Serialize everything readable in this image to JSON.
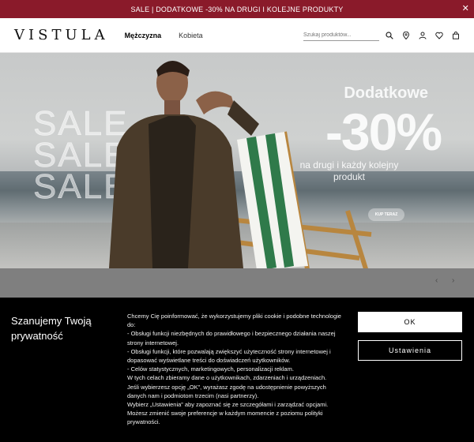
{
  "promo_bar": {
    "text": "SALE | DODATKOWE -30% NA DRUGI I KOLEJNE PRODUKTY",
    "close_glyph": "✕"
  },
  "header": {
    "logo": "VISTULA",
    "nav": [
      {
        "label": "Mężczyzna",
        "active": true
      },
      {
        "label": "Kobieta",
        "active": false
      }
    ],
    "search_placeholder": "Szukaj produktów...",
    "icons": [
      "search-icon",
      "location-pin-icon",
      "account-icon",
      "heart-icon",
      "bag-icon"
    ]
  },
  "hero": {
    "sale_words": [
      "SALE",
      "SALE",
      "SALE"
    ],
    "title": "Dodatkowe",
    "discount": "-30%",
    "subtitle": "na drugi i każdy kolejny produkt",
    "cta": "KUP TERAZ"
  },
  "carousel": {
    "prev_glyph": "‹",
    "next_glyph": "›"
  },
  "cookie": {
    "title": "Szanujemy Twoją prywatność",
    "lines": [
      "Chcemy Cię poinformować, że wykorzystujemy pliki cookie i podobne technologie do:",
      "- Obsługi funkcji niezbędnych do prawidłowego i bezpiecznego działania naszej strony internetowej.",
      "- Obsługi funkcji, które pozwalają zwiększyć użyteczność strony internetowej i dopasować wyświetlane treści do doświadczeń użytkowników.",
      "- Celów statystycznych, marketingowych, personalizacji reklam.",
      "W tych celach zbieramy dane o użytkownikach, zdarzeniach i urządzeniach.",
      "Jeśli wybierzesz opcję „OK”, wyrażasz zgodę na udostępnienie powyższych danych nam i podmiotom trzecim (nasi partnerzy).",
      "Wybierz „Ustawienia” aby zapoznać się ze szczegółami i zarządzać opcjami. Możesz zmienić swoje preferencje w każdym momencie z poziomu polityki prywatności."
    ],
    "ok_label": "OK",
    "settings_label": "Ustawienia"
  },
  "colors": {
    "promo_bar": "#8a1a2a",
    "cookie_bg": "#000000"
  }
}
